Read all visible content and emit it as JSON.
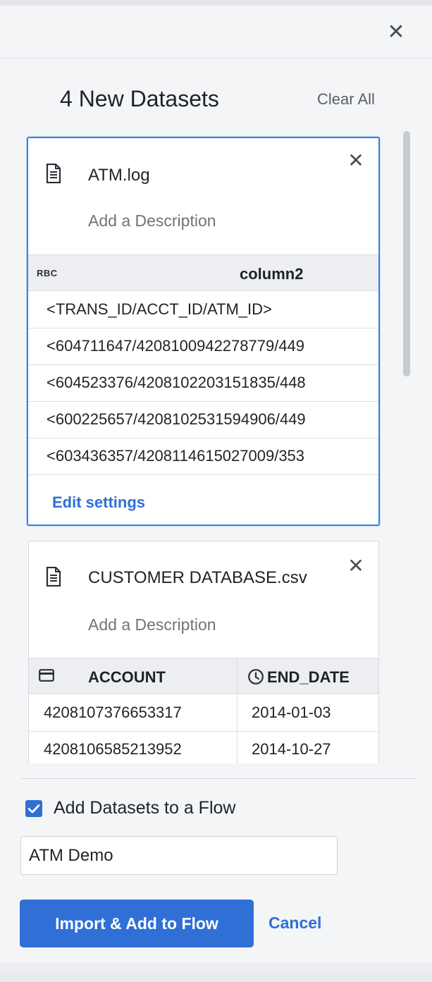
{
  "panel": {
    "close_icon": "close-icon",
    "title": "4 New Datasets",
    "clear_all": "Clear All"
  },
  "datasets": [
    {
      "icon": "document-icon",
      "name": "ATM.log",
      "description_placeholder": "Add a Description",
      "columns": [
        {
          "type_icon": "string-type-icon",
          "type_label": "RBC",
          "name": "column2"
        }
      ],
      "rows": [
        [
          "<TRANS_ID/ACCT_ID/ATM_ID>"
        ],
        [
          "<604711647/4208100942278779/449"
        ],
        [
          "<604523376/4208102203151835/448"
        ],
        [
          "<600225657/4208102531594906/449"
        ],
        [
          "<603436357/4208114615027009/353"
        ]
      ],
      "edit_settings": "Edit settings",
      "selected": true
    },
    {
      "icon": "document-icon",
      "name": "CUSTOMER DATABASE.csv",
      "description_placeholder": "Add a Description",
      "columns": [
        {
          "type_icon": "credit-card-icon",
          "name": "ACCOUNT"
        },
        {
          "type_icon": "clock-icon",
          "name": "END_DATE"
        }
      ],
      "rows": [
        [
          "4208107376653317",
          "2014-01-03"
        ],
        [
          "4208106585213952",
          "2014-10-27"
        ]
      ],
      "selected": false
    }
  ],
  "footer": {
    "checkbox_checked": true,
    "checkbox_label": "Add Datasets to a Flow",
    "flow_name_value": "ATM Demo",
    "import_button": "Import & Add to Flow",
    "cancel": "Cancel"
  },
  "colors": {
    "accent": "#2f6fd6",
    "selected_border": "#3b82e0",
    "background": "#f4f5f7"
  }
}
